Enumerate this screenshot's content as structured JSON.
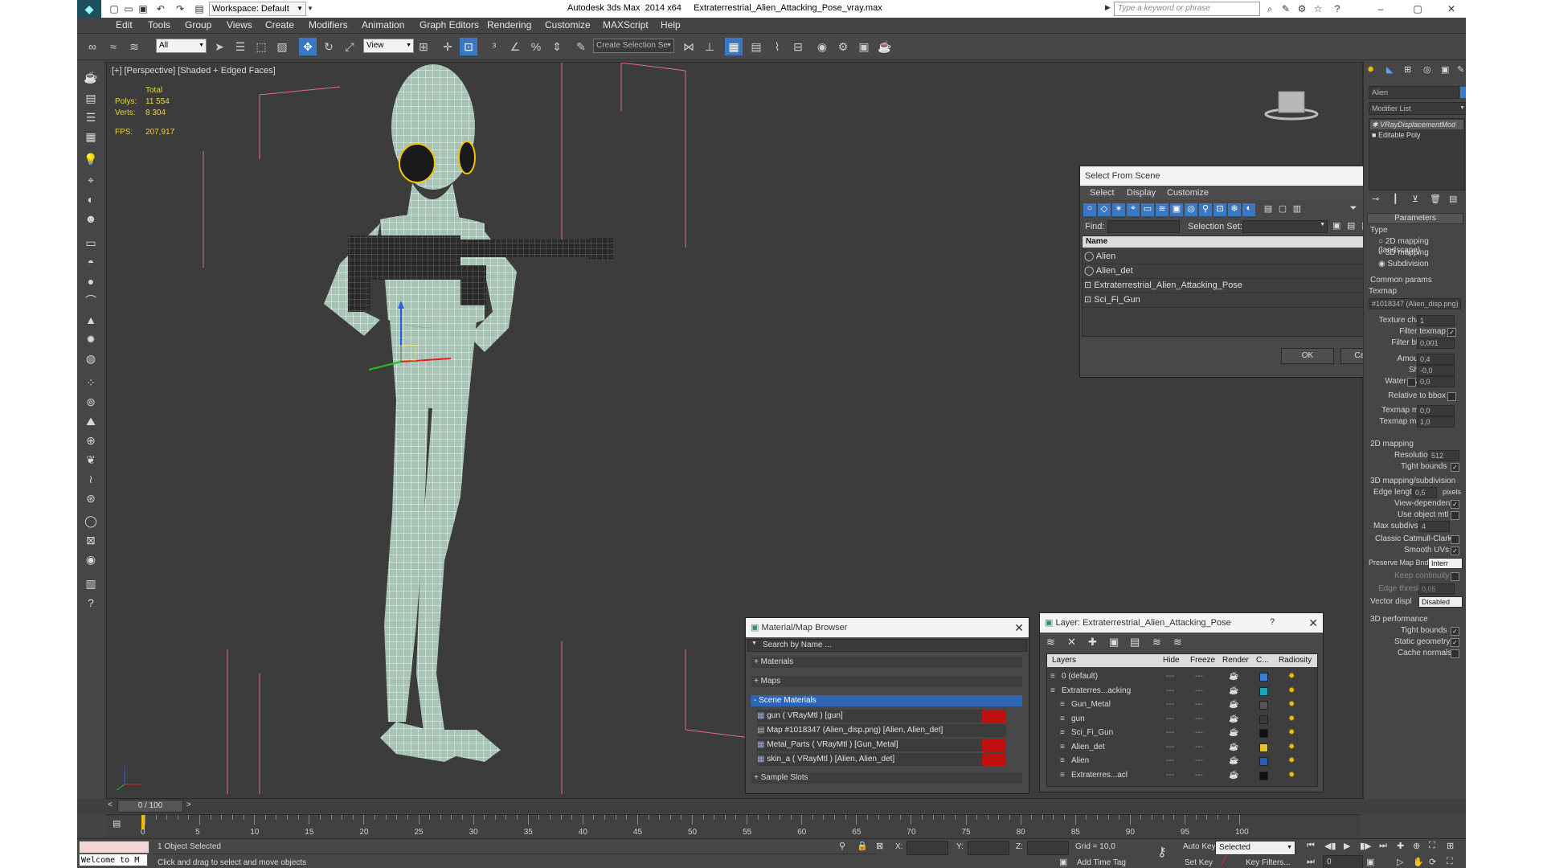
{
  "app": {
    "title": "Autodesk 3ds Max  2014 x64     Extraterrestrial_Alien_Attacking_Pose_vray.max",
    "workspace": "Workspace: Default",
    "search_placeholder": "Type a keyword or phrase"
  },
  "menu": [
    "Edit",
    "Tools",
    "Group",
    "Views",
    "Create",
    "Modifiers",
    "Animation",
    "Graph Editors",
    "Rendering",
    "Customize",
    "MAXScript",
    "Help"
  ],
  "toolbar": {
    "filter": "All",
    "ref_coord": "View",
    "selection_set_placeholder": "Create Selection Se"
  },
  "viewport": {
    "label": "[+] [Perspective] [Shaded + Edged Faces]",
    "stats": {
      "total_label": "Total",
      "polys_label": "Polys:",
      "polys": "11 554",
      "verts_label": "Verts:",
      "verts": "8 304",
      "fps_label": "FPS:",
      "fps": "207,917"
    }
  },
  "select_from_scene": {
    "title": "Select From Scene",
    "tabs": [
      "Select",
      "Display",
      "Customize"
    ],
    "find_label": "Find:",
    "selection_set_label": "Selection Set:",
    "column": "Name",
    "items": [
      "Alien",
      "Alien_det",
      "Extraterrestrial_Alien_Attacking_Pose",
      "Sci_Fi_Gun"
    ],
    "ok": "OK",
    "cancel": "Cancel"
  },
  "material_browser": {
    "title": "Material/Map Browser",
    "search_placeholder": "Search by Name ...",
    "sections": [
      "+ Materials",
      "+ Maps",
      "- Scene Materials",
      "+ Sample Slots"
    ],
    "scene_materials": [
      "gun  ( VRayMtl )  [gun]",
      "Map #1018347 (Alien_disp.png)  [Alien, Alien_det]",
      "Metal_Parts  ( VRayMtl )  [Gun_Metal]",
      "skin_a  ( VRayMtl )  [Alien, Alien_det]"
    ]
  },
  "layer_dialog": {
    "title": "Layer: Extraterrestrial_Alien_Attacking_Pose",
    "help": "?",
    "columns": [
      "Layers",
      "Hide",
      "Freeze",
      "Render",
      "C...",
      "Radiosity"
    ],
    "rows": [
      {
        "name": "0 (default)",
        "color": "#3a7bd5"
      },
      {
        "name": "Extraterres...acking",
        "color": "#1aa5b8"
      },
      {
        "name": "Gun_Metal",
        "color": "#555555"
      },
      {
        "name": "gun",
        "color": "#3a3a3a"
      },
      {
        "name": "Sci_Fi_Gun",
        "color": "#111111"
      },
      {
        "name": "Alien_det",
        "color": "#e1c233"
      },
      {
        "name": "Alien",
        "color": "#2b5fb0"
      },
      {
        "name": "Extraterres...acl",
        "color": "#111111"
      }
    ]
  },
  "command_panel": {
    "object_name": "Alien",
    "modifier_list": "Modifier List",
    "stack": [
      "VRayDisplacementMod",
      "Editable Poly"
    ],
    "rollout_title": "Parameters",
    "type_label": "Type",
    "type_options": [
      "2D mapping (landscape)",
      "3D mapping",
      "Subdivision"
    ],
    "common_params": "Common params",
    "texmap_label": "Texmap",
    "texmap_value": "#1018347 (Alien_disp.png)",
    "params": [
      {
        "label": "Texture chan",
        "value": "1"
      },
      {
        "label": "Filter texmap",
        "value": ""
      },
      {
        "label": "Filter blur",
        "value": "0,001"
      },
      {
        "label": "Amount",
        "value": "0,4"
      },
      {
        "label": "Shift",
        "value": "-0,0"
      },
      {
        "label": "Water level",
        "value": "0,0"
      },
      {
        "label": "Relative to bbox",
        "value": ""
      },
      {
        "label": "Texmap min",
        "value": "0,0"
      },
      {
        "label": "Texmap max",
        "value": "1,0"
      }
    ],
    "mapping2d_title": "2D mapping",
    "resolution_label": "Resolution",
    "resolution": "512",
    "tight_bounds": "Tight bounds",
    "mapping3d_title": "3D mapping/subdivision",
    "edge_length_label": "Edge length",
    "edge_length": "0,5",
    "pixels": "pixels",
    "checks3d": [
      "View-dependent",
      "Use object mtl"
    ],
    "max_subdivs_label": "Max subdivs",
    "max_subdivs": "4",
    "checks3d_b": [
      "Classic Catmull-Clark",
      "Smooth UVs"
    ],
    "preserve_label": "Preserve Map Bnd",
    "preserve_value": "Interr",
    "keep_continuity": "Keep continuity",
    "edge_thresh_label": "Edge thresh",
    "edge_thresh": "0,05",
    "vector_label": "Vector displ",
    "vector_value": "Disabled",
    "perf_title": "3D performance",
    "perf_checks": [
      "Tight bounds",
      "Static geometry",
      "Cache normals"
    ]
  },
  "timeline": {
    "frame": "0 / 100",
    "ticks": [
      "0",
      "5",
      "10",
      "15",
      "20",
      "25",
      "30",
      "35",
      "40",
      "45",
      "50",
      "55",
      "60",
      "65",
      "70",
      "75",
      "80",
      "85",
      "90",
      "95",
      "100"
    ]
  },
  "status": {
    "script": "Welcome to M",
    "selected": "1 Object Selected",
    "prompt": "Click and drag to select and move objects",
    "x_label": "X:",
    "y_label": "Y:",
    "z_label": "Z:",
    "grid": "Grid = 10,0",
    "add_time_tag": "Add Time Tag",
    "auto_key": "Auto Key",
    "set_key": "Set Key",
    "key_mode": "Selected",
    "key_filters": "Key Filters...",
    "frame_field": "0"
  }
}
